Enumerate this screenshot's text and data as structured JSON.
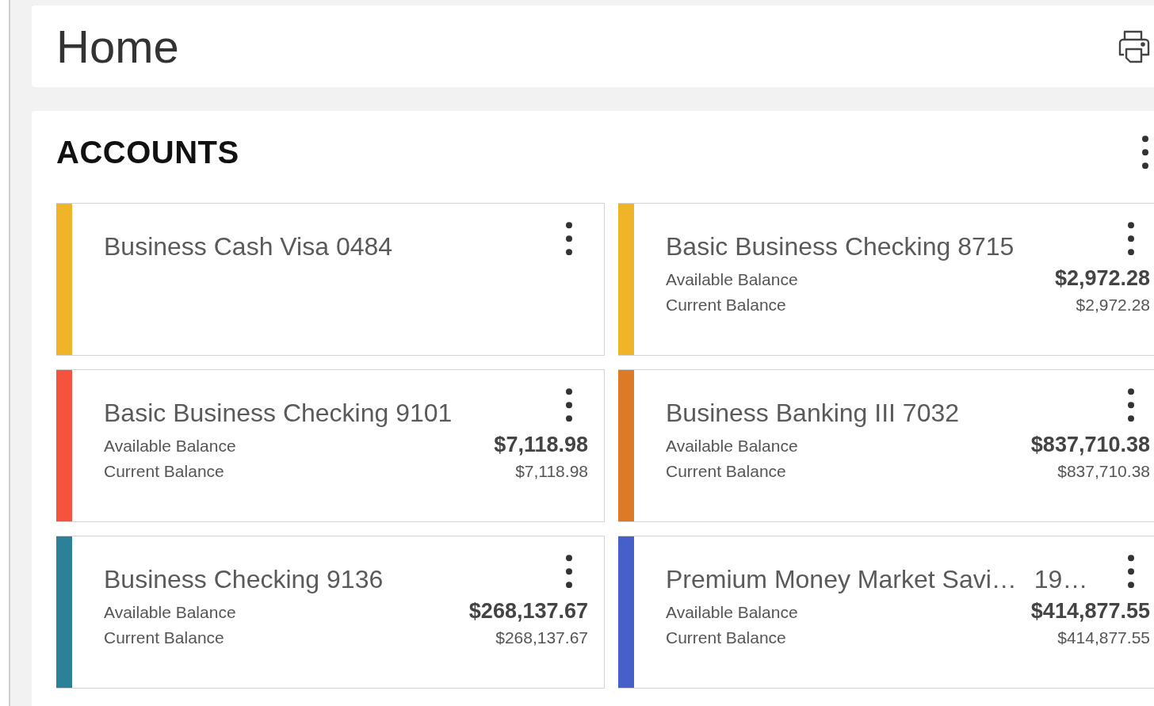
{
  "page": {
    "title": "Home"
  },
  "accounts": {
    "heading": "ACCOUNTS",
    "items": [
      {
        "name": "Business Cash Visa 0484",
        "color": "#f0b429"
      },
      {
        "name": "Basic Business Checking 8715",
        "color": "#f0b429",
        "available_label": "Available Balance",
        "available": "$2,972.28",
        "current_label": "Current Balance",
        "current": "$2,972.28"
      },
      {
        "name": "Basic Business Checking 9101",
        "color": "#f5533d",
        "available_label": "Available Balance",
        "available": "$7,118.98",
        "current_label": "Current Balance",
        "current": "$7,118.98"
      },
      {
        "name": "Business Banking III 7032",
        "color": "#dd7a26",
        "available_label": "Available Balance",
        "available": "$837,710.38",
        "current_label": "Current Balance",
        "current": "$837,710.38"
      },
      {
        "name": "Business Checking 9136",
        "color": "#2b8197",
        "available_label": "Available Balance",
        "available": "$268,137.67",
        "current_label": "Current Balance",
        "current": "$268,137.67"
      },
      {
        "name": "Premium Money Market Savi…",
        "suffix": "19…",
        "color": "#4561c9",
        "available_label": "Available Balance",
        "available": "$414,877.55",
        "current_label": "Current Balance",
        "current": "$414,877.55"
      }
    ]
  }
}
